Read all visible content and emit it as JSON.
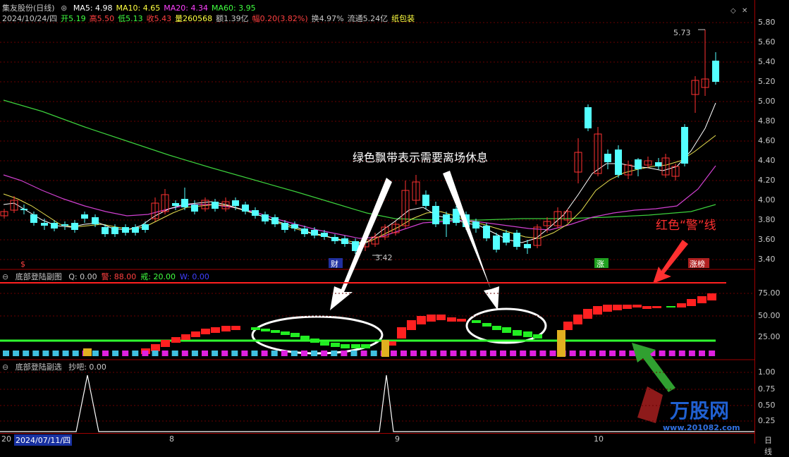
{
  "header": {
    "title": "集友股份(日线)",
    "ma": [
      {
        "label": "MA5: 4.98",
        "color": "#ffffff"
      },
      {
        "label": "MA10: 4.65",
        "color": "#ffff40"
      },
      {
        "label": "MA20: 4.34",
        "color": "#ff40ff"
      },
      {
        "label": "MA60: 3.95",
        "color": "#40ff40"
      }
    ],
    "quote": [
      {
        "label": "2024/10/24/四",
        "color": "#c8c8c8"
      },
      {
        "label": "开5.19",
        "color": "#40ff40"
      },
      {
        "label": "高5.50",
        "color": "#ff4040"
      },
      {
        "label": "低5.13",
        "color": "#40ff40"
      },
      {
        "label": "收5.43",
        "color": "#ff4040"
      },
      {
        "label": "量260568",
        "color": "#ffff40"
      },
      {
        "label": "额1.39亿",
        "color": "#c8c8c8"
      },
      {
        "label": "幅0.20(3.82%)",
        "color": "#ff4040"
      },
      {
        "label": "换4.97%",
        "color": "#c8c8c8"
      },
      {
        "label": "流通5.24亿",
        "color": "#c8c8c8"
      },
      {
        "label": "纸包装",
        "color": "#ffff40"
      }
    ]
  },
  "price_axis": [
    "5.80",
    "5.60",
    "5.40",
    "5.20",
    "5.00",
    "4.80",
    "4.60",
    "4.40",
    "4.20",
    "4.00",
    "3.80",
    "3.60",
    "3.40"
  ],
  "indicator_axis": [
    "75.00",
    "50.00",
    "25.00"
  ],
  "signal_axis": [
    "1.00",
    "0.75",
    "0.50",
    "0.25"
  ],
  "annotations": {
    "high_label": "5.73",
    "low_label": "3.42",
    "green_band_note": "绿色飘带表示需要离场休息",
    "red_line_note": "红色“警”线",
    "marker_cai": "财",
    "marker_zhang": "涨",
    "marker_zhangbang": "涨榜",
    "marker_s": "$"
  },
  "panel2": {
    "name": "底部登陆副图",
    "items": [
      {
        "label": "Q: 0.00",
        "color": "#c8c8c8"
      },
      {
        "label": "警: 88.00",
        "color": "#ff4040"
      },
      {
        "label": "戒: 20.00",
        "color": "#40ff40"
      },
      {
        "label": "W: 0.00",
        "color": "#4040ff"
      }
    ]
  },
  "panel3": {
    "name": "底部登陆副选",
    "items": [
      {
        "label": "抄吧: 0.00",
        "color": "#c8c8c8"
      }
    ]
  },
  "bottom_axis": {
    "cursor_date": "2024/07/11/四",
    "year_prefix": "20",
    "months": [
      "8",
      "9",
      "10"
    ],
    "period": "日线"
  },
  "watermark": {
    "brand": "万股网",
    "url": "www.201082.com"
  },
  "colors": {
    "up": "#ff3232",
    "down": "#54ffff",
    "frame": "#a00000"
  }
}
